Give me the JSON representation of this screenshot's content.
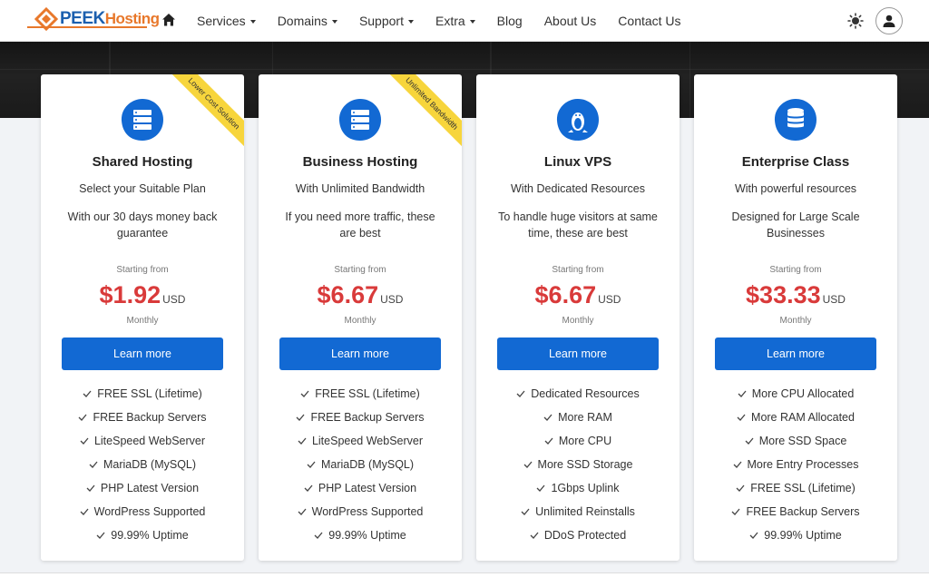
{
  "header": {
    "logo": {
      "peek": "PEEK",
      "hosting": "Hosting"
    },
    "menu": [
      {
        "label": "Services",
        "dropdown": true
      },
      {
        "label": "Domains",
        "dropdown": true
      },
      {
        "label": "Support",
        "dropdown": true
      },
      {
        "label": "Extra",
        "dropdown": true
      },
      {
        "label": "Blog",
        "dropdown": false
      },
      {
        "label": "About Us",
        "dropdown": false
      },
      {
        "label": "Contact Us",
        "dropdown": false
      }
    ],
    "icons": {
      "home": "home-icon",
      "theme": "sun-icon",
      "account": "user-icon"
    }
  },
  "colors": {
    "accent": "#1269d3",
    "price": "#d93a3a",
    "ribbon": "#f7d53c",
    "logo_blue": "#1b5fae",
    "logo_orange": "#e8782b"
  },
  "plans": [
    {
      "icon": "server-icon",
      "ribbon": "Lower Cost Solution",
      "title": "Shared Hosting",
      "subtitle": "Select your Suitable Plan",
      "description": "With our 30 days money back guarantee",
      "starting": "Starting from",
      "price": "$1.92",
      "currency": "USD",
      "period": "Monthly",
      "button": "Learn more",
      "features": [
        "FREE SSL (Lifetime)",
        "FREE Backup Servers",
        "LiteSpeed WebServer",
        "MariaDB (MySQL)",
        "PHP Latest Version",
        "WordPress Supported",
        "99.99% Uptime"
      ]
    },
    {
      "icon": "server-icon",
      "ribbon": "Unlimited Bandwidth",
      "title": "Business Hosting",
      "subtitle": "With Unlimited Bandwidth",
      "description": "If you need more traffic, these are best",
      "starting": "Starting from",
      "price": "$6.67",
      "currency": "USD",
      "period": "Monthly",
      "button": "Learn more",
      "features": [
        "FREE SSL (Lifetime)",
        "FREE Backup Servers",
        "LiteSpeed WebServer",
        "MariaDB (MySQL)",
        "PHP Latest Version",
        "WordPress Supported",
        "99.99% Uptime"
      ]
    },
    {
      "icon": "linux-icon",
      "ribbon": "",
      "title": "Linux VPS",
      "subtitle": "With Dedicated Resources",
      "description": "To handle huge visitors at same time, these are best",
      "starting": "Starting from",
      "price": "$6.67",
      "currency": "USD",
      "period": "Monthly",
      "button": "Learn more",
      "features": [
        "Dedicated Resources",
        "More RAM",
        "More CPU",
        "More SSD Storage",
        "1Gbps Uplink",
        "Unlimited Reinstalls",
        "DDoS Protected"
      ]
    },
    {
      "icon": "database-icon",
      "ribbon": "",
      "title": "Enterprise Class",
      "subtitle": "With powerful resources",
      "description": "Designed for Large Scale Businesses",
      "starting": "Starting from",
      "price": "$33.33",
      "currency": "USD",
      "period": "Monthly",
      "button": "Learn more",
      "features": [
        "More CPU Allocated",
        "More RAM Allocated",
        "More SSD Space",
        "More Entry Processes",
        "FREE SSL (Lifetime)",
        "FREE Backup Servers",
        "99.99% Uptime"
      ]
    }
  ]
}
